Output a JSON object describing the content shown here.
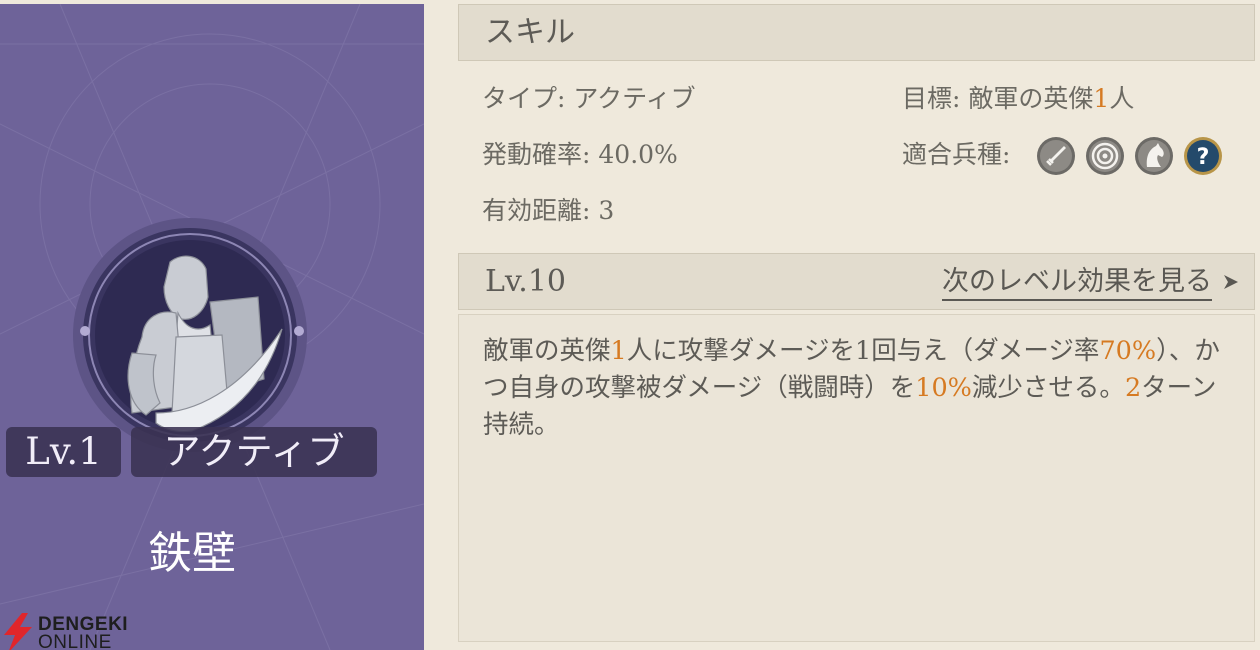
{
  "skill_card": {
    "level_badge": "Lv.1",
    "type_badge": "アクティブ",
    "skill_name": "鉄壁",
    "portrait_icon": "warrior-with-sword-and-shield-icon"
  },
  "watermark": {
    "line1": "DENGEKI",
    "line2": "ONLINE"
  },
  "skill_section": {
    "title": "スキル",
    "type_label": "タイプ:",
    "type_value": "アクティブ",
    "rate_label": "発動確率:",
    "rate_value": "40.0%",
    "range_label": "有効距離:",
    "range_value": "3",
    "target_label": "目標:",
    "target_prefix": "敵軍の英傑",
    "target_count": "1",
    "target_suffix": "人",
    "units_label": "適合兵種:",
    "unit_icons": [
      "sword-icon",
      "target-icon",
      "horse-icon",
      "question-icon"
    ]
  },
  "level_section": {
    "level": "Lv.10",
    "next_link": "次のレベル効果を見る"
  },
  "description": {
    "p1": "敵軍の英傑",
    "n1": "1",
    "p2": "人に攻撃ダメージを1回与え（ダメージ率",
    "n2": "70%",
    "p3": "）、かつ自身の攻撃被ダメージ（戦闘時）を",
    "n3": "10%",
    "p4": "減少させる。",
    "n4": "2",
    "p5": "ターン持続。"
  },
  "colors": {
    "card_purple": "#6e6399",
    "highlight_orange": "#d67a22",
    "panel_bg": "#efe9dc"
  }
}
